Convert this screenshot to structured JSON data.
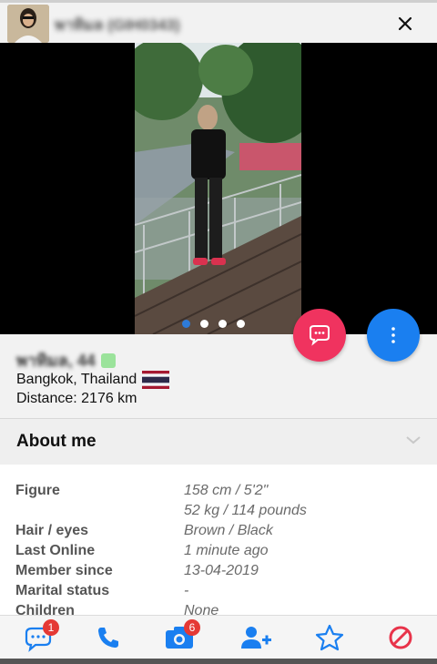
{
  "header": {
    "title": "พาทิมล (GIH0343)",
    "close_icon": "close-icon"
  },
  "photo": {
    "dots_total": 4,
    "dots_active": 1
  },
  "profile": {
    "name_age": "พาทิมล, 44",
    "location": "Bangkok, Thailand",
    "flag": "thailand-flag",
    "distance": "Distance: 2176 km"
  },
  "about": {
    "title": "About me"
  },
  "details": [
    {
      "key": "Figure",
      "value": "158 cm / 5'2\""
    },
    {
      "key": "",
      "value": "52 kg / 114 pounds"
    },
    {
      "key": "Hair / eyes",
      "value": "Brown / Black"
    },
    {
      "key": "Last Online",
      "value": "1 minute ago"
    },
    {
      "key": "Member since",
      "value": "13-04-2019"
    },
    {
      "key": "Marital status",
      "value": "-"
    },
    {
      "key": "Children",
      "value": "None"
    }
  ],
  "bottom_bar": {
    "messages_badge": "1",
    "photos_badge": "6"
  },
  "colors": {
    "chat_button": "#f0335f",
    "more_button": "#1a7ff0",
    "icon_blue": "#1a7ff0",
    "block_red": "#e8334a",
    "badge_red": "#e53935"
  }
}
